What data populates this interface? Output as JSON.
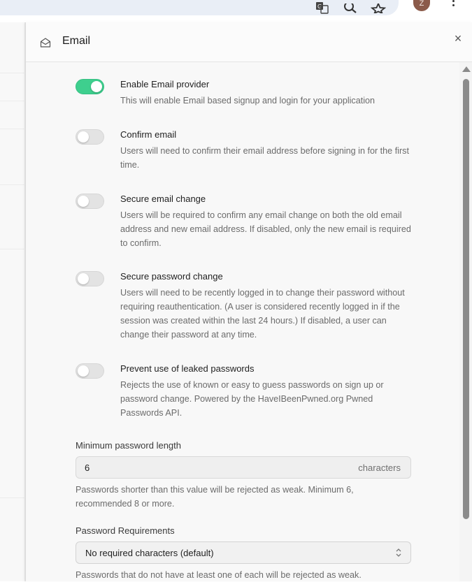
{
  "browser": {
    "icons": [
      "translate-icon",
      "zoom-icon",
      "bookmark-star-icon"
    ],
    "avatar_initial": "Z"
  },
  "panel": {
    "title": "Email",
    "icon": "mail-open-icon",
    "close_glyph": "×"
  },
  "settings": [
    {
      "label": "Enable Email provider",
      "description": "This will enable Email based signup and login for your application",
      "enabled": true
    },
    {
      "label": "Confirm email",
      "description": "Users will need to confirm their email address before signing in for the first time.",
      "enabled": false
    },
    {
      "label": "Secure email change",
      "description": "Users will be required to confirm any email change on both the old email address and new email address. If disabled, only the new email is required to confirm.",
      "enabled": false
    },
    {
      "label": "Secure password change",
      "description": "Users will need to be recently logged in to change their password without requiring reauthentication. (A user is considered recently logged in if the session was created within the last 24 hours.) If disabled, a user can change their password at any time.",
      "enabled": false
    },
    {
      "label": "Prevent use of leaked passwords",
      "description": "Rejects the use of known or easy to guess passwords on sign up or password change. Powered by the HaveIBeenPwned.org Pwned Passwords API.",
      "enabled": false
    }
  ],
  "min_password": {
    "label": "Minimum password length",
    "value": "6",
    "suffix": "characters",
    "help": "Passwords shorter than this value will be rejected as weak. Minimum 6, recommended 8 or more."
  },
  "password_requirements": {
    "label": "Password Requirements",
    "selected": "No required characters (default)",
    "help": "Passwords that do not have at least one of each will be rejected as weak."
  },
  "colors": {
    "toggle_on": "#3ecf8e",
    "toggle_off": "#e3e3e3"
  }
}
